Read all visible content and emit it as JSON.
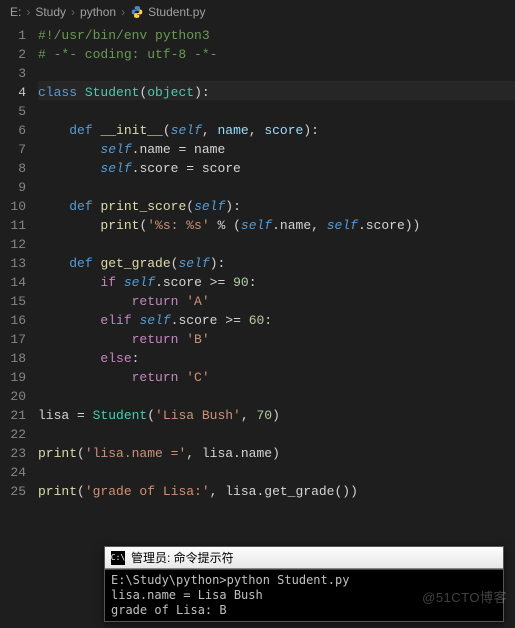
{
  "breadcrumb": {
    "drive": "E:",
    "p1": "Study",
    "p2": "python",
    "file": "Student.py"
  },
  "code": {
    "l1": "#!/usr/bin/env python3",
    "l2": "# -*- coding: utf-8 -*-",
    "l4_class": "class",
    "l4_name": "Student",
    "l4_obj": "object",
    "def": "def",
    "self": "self",
    "init": "__init__",
    "p_name": "name",
    "p_score": "score",
    "l7_a": "self",
    "l7_b": ".name = name",
    "l8_a": "self",
    "l8_b": ".score = score",
    "print_score": "print_score",
    "l11_print": "print",
    "l11_str": "'%s: %s'",
    "l11_pct": " % (",
    "l11_name": ".name, ",
    "l11_score": ".score))",
    "get_grade": "get_grade",
    "if": "if",
    "elif": "elif",
    "else": "else",
    "return": "return",
    "l14_cmp": ".score >= ",
    "n90": "90",
    "n60": "60",
    "gA": "'A'",
    "gB": "'B'",
    "gC": "'C'",
    "l21_var": "lisa",
    "l21_eq": " = ",
    "l21_cls": "Student",
    "l21_args_s": "'Lisa Bush'",
    "l21_args_n": "70",
    "l23_p": "print",
    "l23_s": "'lisa.name ='",
    "l23_rest": ", lisa.name)",
    "l25_p": "print",
    "l25_s": "'grade of Lisa:'",
    "l25_rest": ", lisa.get_grade())"
  },
  "terminal": {
    "title": "管理员: 命令提示符",
    "line1": "E:\\Study\\python>python Student.py",
    "line2": "lisa.name = Lisa Bush",
    "line3": "grade of Lisa: B"
  },
  "watermark": "@51CTO博客"
}
